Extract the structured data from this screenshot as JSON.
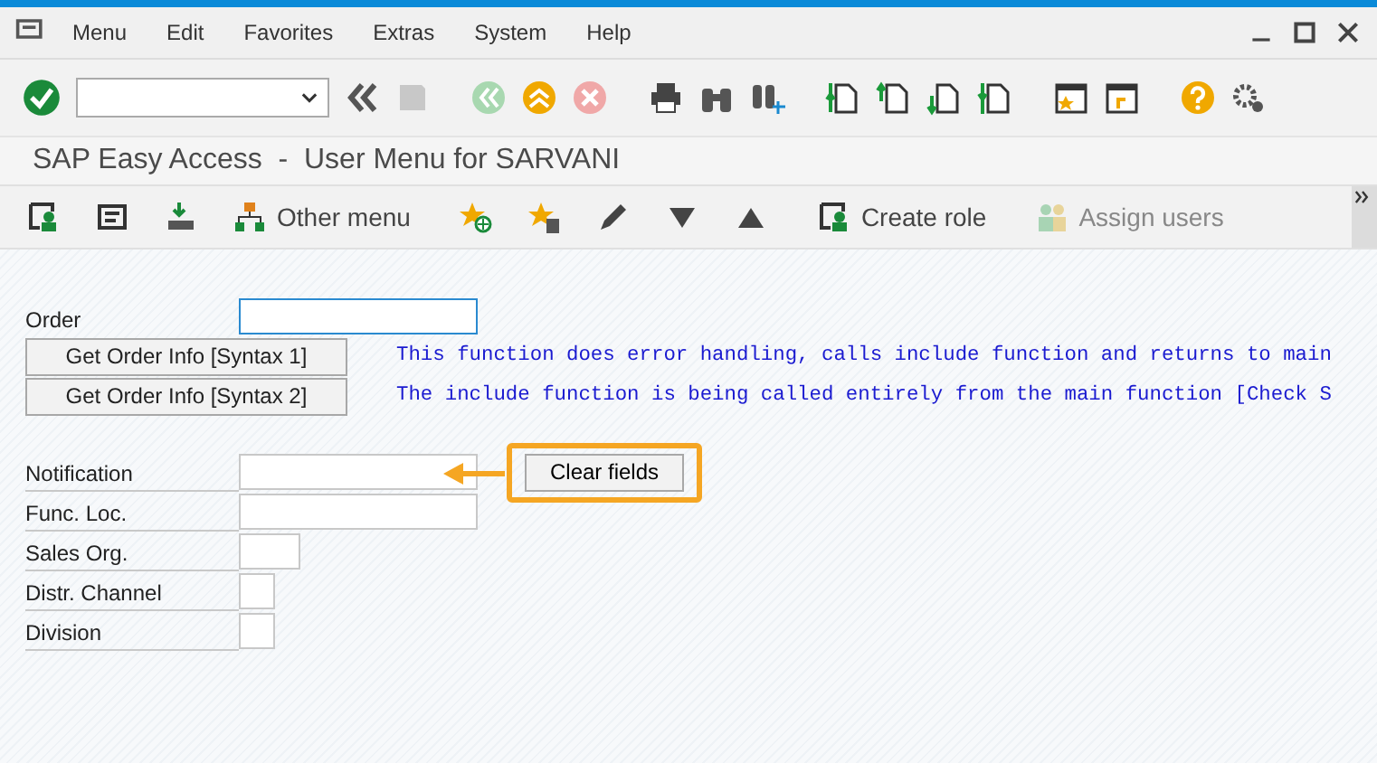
{
  "menu_bar": {
    "items": [
      "Menu",
      "Edit",
      "Favorites",
      "Extras",
      "System",
      "Help"
    ]
  },
  "title": "SAP Easy Access  -  User Menu for SARVANI",
  "app_toolbar": {
    "buttons": [
      {
        "label": "Other menu",
        "disabled": false
      },
      {
        "label": "Create role",
        "disabled": false
      },
      {
        "label": "Assign users",
        "disabled": true
      }
    ]
  },
  "order": {
    "label": "Order"
  },
  "order_buttons": [
    {
      "label": "Get Order Info [Syntax 1]",
      "note": "This function does error handling, calls include function and returns to main"
    },
    {
      "label": "Get Order Info [Syntax 2]",
      "note": "The include function is being called entirely from the main function [Check S"
    }
  ],
  "fields": [
    {
      "label": "Notification"
    },
    {
      "label": "Func. Loc."
    },
    {
      "label": "Sales Org."
    },
    {
      "label": "Distr. Channel"
    },
    {
      "label": "Division"
    }
  ],
  "clear_button": {
    "label": "Clear fields",
    "highlighted": true
  }
}
